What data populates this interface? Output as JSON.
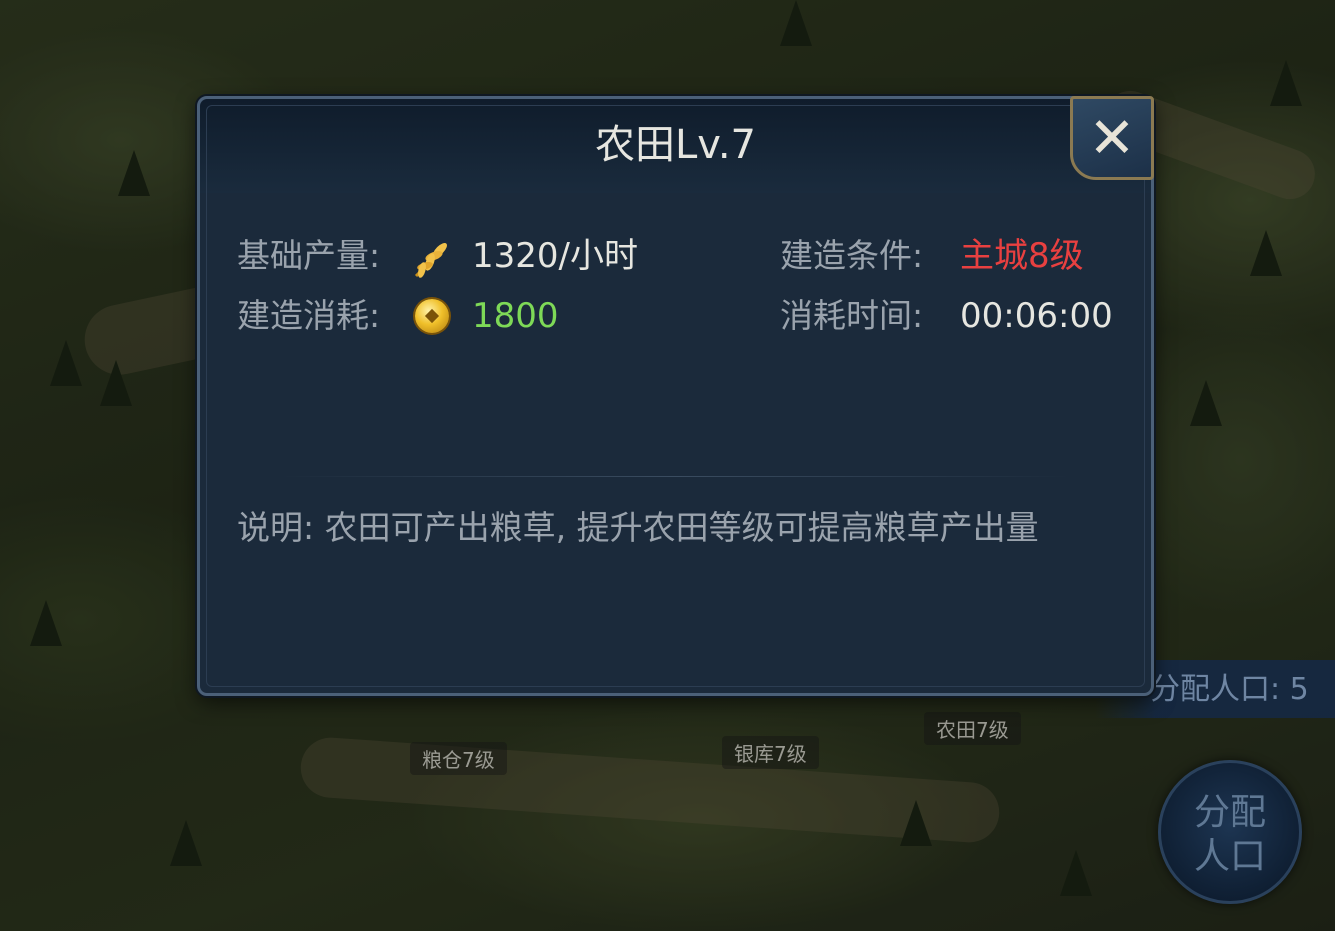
{
  "dialog": {
    "title": "农田Lv.7",
    "close_icon": "close-icon",
    "base_output_label": "基础产量:",
    "base_output_icon": "wheat-icon",
    "base_output_value": "1320/小时",
    "build_condition_label": "建造条件:",
    "build_condition_value": "主城8级",
    "build_cost_label": "建造消耗:",
    "build_cost_icon": "coin-icon",
    "build_cost_value": "1800",
    "build_time_label": "消耗时间:",
    "build_time_value": "00:06:00",
    "description": "说明: 农田可产出粮草, 提升农田等级可提高粮草产出量"
  },
  "map": {
    "labels": [
      "粮仓7级",
      "银库7级",
      "农田7级"
    ],
    "population_text": "分配人口: 5",
    "assign_button": [
      "分配",
      "人口"
    ]
  },
  "colors": {
    "value_green": "#7ed957",
    "condition_red": "#e84040",
    "dialog_bg": "#1b2a3b"
  }
}
